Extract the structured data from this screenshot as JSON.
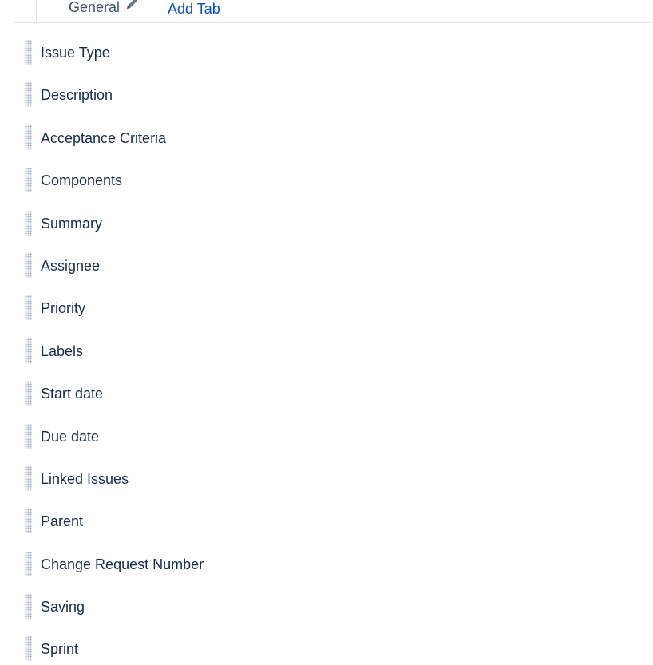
{
  "tabs": {
    "active": {
      "label": "General",
      "edit_icon": "pencil-icon"
    },
    "add_tab_label": "Add Tab"
  },
  "fields": [
    {
      "label": "Issue Type"
    },
    {
      "label": "Description"
    },
    {
      "label": "Acceptance Criteria"
    },
    {
      "label": "Components"
    },
    {
      "label": "Summary"
    },
    {
      "label": "Assignee"
    },
    {
      "label": "Priority"
    },
    {
      "label": "Labels"
    },
    {
      "label": "Start date"
    },
    {
      "label": "Due date"
    },
    {
      "label": "Linked Issues"
    },
    {
      "label": "Parent"
    },
    {
      "label": "Change Request Number"
    },
    {
      "label": "Saving"
    },
    {
      "label": "Sprint"
    }
  ],
  "colors": {
    "link": "#0052cc",
    "text": "#172b4d",
    "tab_text": "#42526e",
    "border": "#dfe1e6",
    "handle_dots": "#a5adba"
  }
}
